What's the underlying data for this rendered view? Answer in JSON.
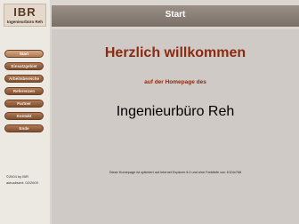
{
  "sidebar": {
    "logo": "IBR",
    "logo_subtitle": "Ingenieurbüro Reh",
    "nav": [
      {
        "label": "Start",
        "active": true
      },
      {
        "label": "Einsatzgebiet",
        "active": false
      },
      {
        "label": "Arbeitsbereiche",
        "active": false
      },
      {
        "label": "Referenzen",
        "active": false
      },
      {
        "label": "Partner",
        "active": false
      },
      {
        "label": "Kontakt",
        "active": false
      },
      {
        "label": "Ende",
        "active": false
      }
    ],
    "copyright": "©2004 by  IBR",
    "updated": "aktualisiert: 02/2009"
  },
  "header": {
    "title": "Start"
  },
  "main": {
    "welcome": "Herzlich willkommen",
    "tagline": "auf der Homepage des",
    "company": "Ingenieurbüro Reh",
    "browser_note": "Diese Homepage ist optimiert auf Internet Explorer 6.0 und eine Farbtiefe von 1024x768"
  },
  "colors": {
    "accent_text": "#8a2a10",
    "nav_button": "#8e5b39",
    "header_bar": "#8a7f77"
  }
}
